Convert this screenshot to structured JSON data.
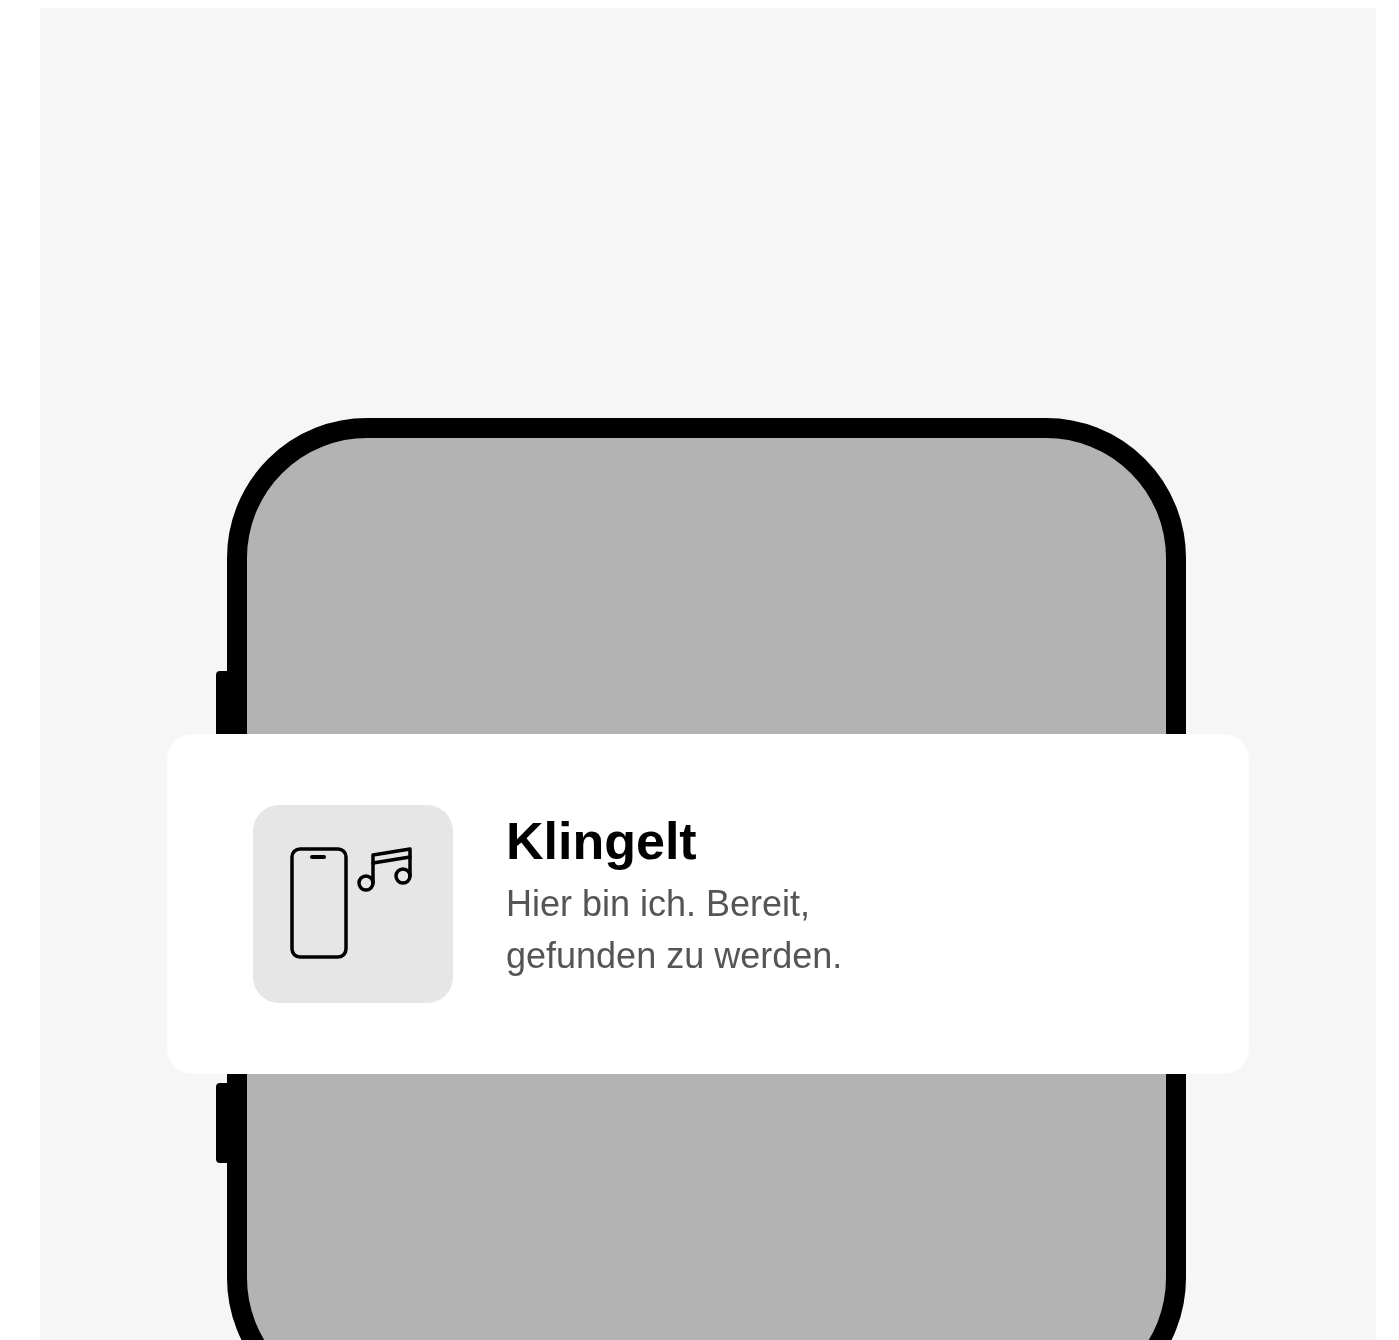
{
  "notification": {
    "title": "Klingelt",
    "message": "Hier bin ich. Bereit,\ngefunden zu werden."
  }
}
